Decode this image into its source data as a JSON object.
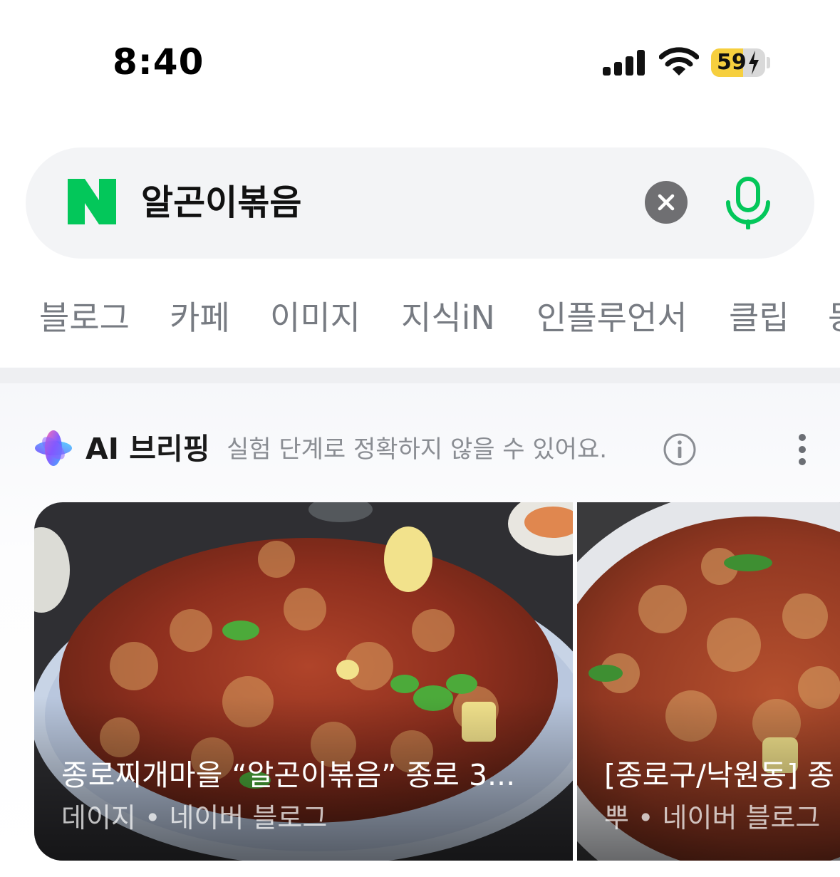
{
  "status_bar": {
    "time": "8:40",
    "battery_level": "59",
    "battery_fraction": 0.59,
    "icons": [
      "signal-icon",
      "wifi-icon",
      "battery-charging-icon"
    ]
  },
  "search": {
    "logo": "N",
    "query": "알곤이볶음",
    "icons": [
      "clear-icon",
      "microphone-icon"
    ]
  },
  "tabs": [
    "블로그",
    "카페",
    "이미지",
    "지식iN",
    "인플루언서",
    "클립",
    "동"
  ],
  "ai_briefing": {
    "title": "AI 브리핑",
    "description": "실험 단계로 정확하지 않을 수 있어요.",
    "icons": [
      "ai-sparkle-icon",
      "info-icon",
      "more-vertical-icon"
    ]
  },
  "cards": [
    {
      "title": "종로찌개마을 “알곤이볶음” 종로 3...",
      "source": "데이지 • 네이버 블로그"
    },
    {
      "title": "[종로구/낙원동] 종",
      "source": "뿌 • 네이버 블로그"
    }
  ],
  "colors": {
    "naver_green": "#03c75a",
    "search_bg": "#f3f4f6",
    "battery_yellow": "#f6cf3e",
    "tab_text": "#777b82"
  }
}
